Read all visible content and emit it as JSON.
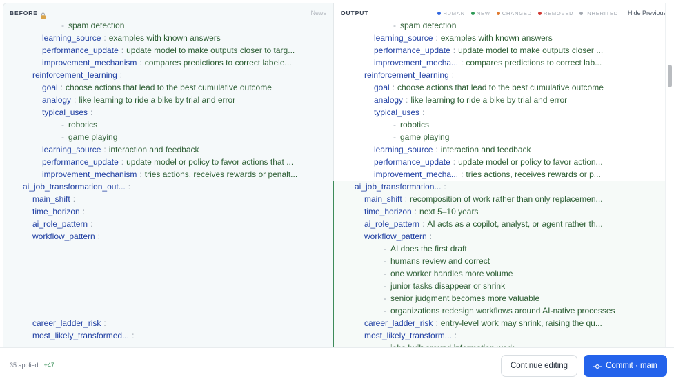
{
  "before_pane": {
    "title": "BEFORE",
    "lock_icon": "lock-icon",
    "right_label": "News",
    "lines": [
      {
        "indent": 1,
        "dash": true,
        "text": "spam detection"
      },
      {
        "indent": 0,
        "key": "learning_source",
        "value": "examples with known answers"
      },
      {
        "indent": 0,
        "key": "performance_update",
        "value": "update model to make outputs closer to targ..."
      },
      {
        "indent": 0,
        "key": "improvement_mechanism",
        "value": "compares predictions to correct labele..."
      },
      {
        "indent": -1,
        "key": "reinforcement_learning",
        "value": ""
      },
      {
        "indent": 0,
        "key": "goal",
        "value": "choose actions that lead to the best cumulative outcome"
      },
      {
        "indent": 0,
        "key": "analogy",
        "value": "like learning to ride a bike by trial and error"
      },
      {
        "indent": 0,
        "key": "typical_uses",
        "value": ""
      },
      {
        "indent": 1,
        "dash": true,
        "text": "robotics"
      },
      {
        "indent": 1,
        "dash": true,
        "text": "game playing"
      },
      {
        "indent": 0,
        "key": "learning_source",
        "value": "interaction and feedback"
      },
      {
        "indent": 0,
        "key": "performance_update",
        "value": "update model or policy to favor actions that ..."
      },
      {
        "indent": 0,
        "key": "improvement_mechanism",
        "value": "tries actions, receives rewards or penalt..."
      },
      {
        "indent": -2,
        "key": "ai_job_transformation_out...",
        "value": ""
      },
      {
        "indent": -1,
        "key": "main_shift",
        "value": ""
      },
      {
        "indent": -1,
        "key": "time_horizon",
        "value": ""
      },
      {
        "indent": -1,
        "key": "ai_role_pattern",
        "value": ""
      },
      {
        "indent": -1,
        "key": "workflow_pattern",
        "value": ""
      },
      {
        "blank": true
      },
      {
        "blank": true
      },
      {
        "blank": true
      },
      {
        "blank": true
      },
      {
        "blank": true
      },
      {
        "blank": true
      },
      {
        "indent": -1,
        "key": "career_ladder_risk",
        "value": ""
      },
      {
        "indent": -1,
        "key": "most_likely_transformed...",
        "value": ""
      }
    ]
  },
  "output_pane": {
    "title": "OUTPUT",
    "legend": [
      {
        "label": "HUMAN",
        "color": "#2f66e0"
      },
      {
        "label": "NEW",
        "color": "#2f9a56"
      },
      {
        "label": "CHANGED",
        "color": "#e07a2f"
      },
      {
        "label": "REMOVED",
        "color": "#d13a34"
      },
      {
        "label": "INHERITED",
        "color": "#a3a8b0"
      }
    ],
    "hide_previous_label": "Hide Previous",
    "lines": [
      {
        "indent": 1,
        "dash": true,
        "text": "spam detection"
      },
      {
        "indent": 0,
        "key": "learning_source",
        "value": "examples with known answers"
      },
      {
        "indent": 0,
        "key": "performance_update",
        "value": "update model to make outputs closer ..."
      },
      {
        "indent": 0,
        "key": "improvement_mecha...",
        "value": "compares predictions to correct lab..."
      },
      {
        "indent": -1,
        "key": "reinforcement_learning",
        "value": ""
      },
      {
        "indent": 0,
        "key": "goal",
        "value": "choose actions that lead to the best cumulative outcome"
      },
      {
        "indent": 0,
        "key": "analogy",
        "value": "like learning to ride a bike by trial and error"
      },
      {
        "indent": 0,
        "key": "typical_uses",
        "value": ""
      },
      {
        "indent": 1,
        "dash": true,
        "text": "robotics"
      },
      {
        "indent": 1,
        "dash": true,
        "text": "game playing"
      },
      {
        "indent": 0,
        "key": "learning_source",
        "value": "interaction and feedback"
      },
      {
        "indent": 0,
        "key": "performance_update",
        "value": "update model or policy to favor action..."
      },
      {
        "indent": 0,
        "key": "improvement_mecha...",
        "value": "tries actions, receives rewards or p..."
      },
      {
        "indent": -2,
        "key": "ai_job_transformation...",
        "value": ""
      },
      {
        "indent": -1,
        "key": "main_shift",
        "value": "recomposition of work rather than only replacemen..."
      },
      {
        "indent": -1,
        "key": "time_horizon",
        "value": "next 5–10 years"
      },
      {
        "indent": -1,
        "key": "ai_role_pattern",
        "value": "AI acts as a copilot, analyst, or agent rather th..."
      },
      {
        "indent": -1,
        "key": "workflow_pattern",
        "value": ""
      },
      {
        "indent": 0,
        "dash": true,
        "text": "AI does the first draft"
      },
      {
        "indent": 0,
        "dash": true,
        "text": "humans review and correct"
      },
      {
        "indent": 0,
        "dash": true,
        "text": "one worker handles more volume"
      },
      {
        "indent": 0,
        "dash": true,
        "text": "junior tasks disappear or shrink"
      },
      {
        "indent": 0,
        "dash": true,
        "text": "senior judgment becomes more valuable"
      },
      {
        "indent": 0,
        "dash": true,
        "text": "organizations redesign workflows around AI-native processes"
      },
      {
        "indent": -1,
        "key": "career_ladder_risk",
        "value": "entry-level work may shrink, raising the qu..."
      },
      {
        "indent": -1,
        "key": "most_likely_transform...",
        "value": ""
      },
      {
        "indent": 0,
        "dash": true,
        "text": "jobs built around information work"
      }
    ]
  },
  "footer": {
    "applied_text": "35 applied ·",
    "plus_text": "+47",
    "continue_label": "Continue editing",
    "commit_icon": "commit-icon",
    "commit_label": "Commit · main"
  }
}
